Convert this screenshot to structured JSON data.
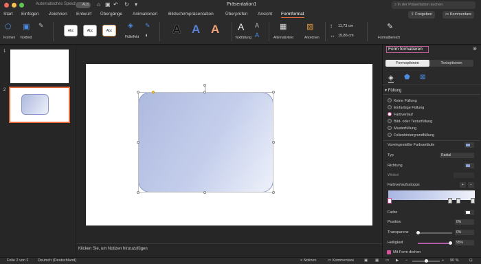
{
  "titlebar": {
    "autosave_label": "Automatisches Speichern",
    "autosave_state": "AUS",
    "doc_title": "Präsentation1",
    "search_placeholder": "In der Präsentation suchen"
  },
  "tabs": [
    "Start",
    "Einfügen",
    "Zeichnen",
    "Entwurf",
    "Übergänge",
    "Animationen",
    "Bildschirmpräsentation",
    "Überprüfen",
    "Ansicht",
    "Formformat"
  ],
  "active_tab": "Formformat",
  "share_buttons": {
    "share": "Freigeben",
    "comments": "Kommentare"
  },
  "ribbon": {
    "formen": "Formen",
    "textfeld": "Textfeld",
    "style_samples": [
      "Abc",
      "Abc",
      "Abc"
    ],
    "fuelleffekt": "Fülleffekt",
    "wordart": [
      "A",
      "A",
      "A"
    ],
    "textfuellung": "Textfüllung",
    "alternativtext": "Alternativtext",
    "anordnen": "Anordnen",
    "height": "11,73 cm",
    "width": "15,86 cm",
    "formatbereich": "Formatbereich"
  },
  "slides": [
    "1",
    "2"
  ],
  "notes_placeholder": "Klicken Sie, um Notizen hinzuzufügen",
  "pane": {
    "title": "Form formatieren",
    "tabs": {
      "form": "Formoptionen",
      "text": "Textoptionen"
    },
    "section": "Füllung",
    "fill_options": [
      "Keine Füllung",
      "Einfarbige Füllung",
      "Farbverlauf",
      "Bild- oder Texturfüllung",
      "Musterfüllung",
      "Folienhintergrundfüllung"
    ],
    "selected_fill": "Farbverlauf",
    "preset_label": "Voreingestellte Farbverläufe",
    "type_label": "Typ",
    "type_value": "Radial",
    "direction_label": "Richtung",
    "angle_label": "Winkel",
    "stops_label": "Farbverlaufsstopps",
    "color_label": "Farbe",
    "position_label": "Position",
    "position_value": "0%",
    "transparency_label": "Transparenz",
    "transparency_value": "0%",
    "brightness_label": "Helligkeit",
    "brightness_value": "95%",
    "brightness_level": 0.95,
    "rotate_label": "Mit Form drehen"
  },
  "status": {
    "slide_info": "Folie 2 von 2",
    "language": "Deutsch (Deutschland)",
    "notes": "Notizen",
    "comments": "Kommentare",
    "zoom": "90 %"
  },
  "colors": {
    "accent": "#e06a3c",
    "selection": "#d7549d",
    "shape_fill": "#aeb9df"
  }
}
